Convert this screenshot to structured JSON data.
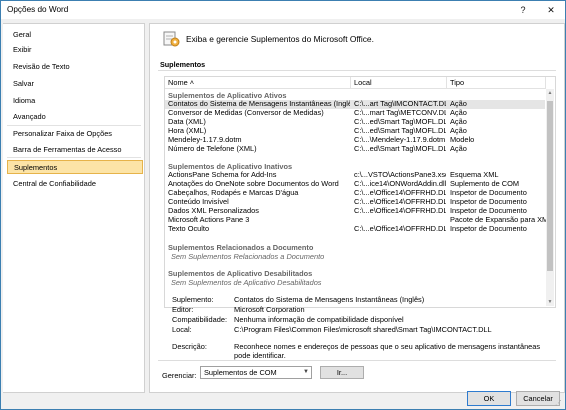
{
  "window": {
    "title": "Opções do Word",
    "help_label": "?",
    "close_label": "✕"
  },
  "sidebar": {
    "items": [
      {
        "label": "Geral",
        "selected": false
      },
      {
        "label": "Exibir",
        "selected": false
      },
      {
        "label": "Revisão de Texto",
        "selected": false
      },
      {
        "label": "Salvar",
        "selected": false
      },
      {
        "label": "Idioma",
        "selected": false
      },
      {
        "label": "Avançado",
        "selected": false
      },
      {
        "label": "Personalizar Faixa de Opções",
        "selected": false
      },
      {
        "label": "Barra de Ferramentas de Acesso Rápido",
        "selected": false
      },
      {
        "label": "Suplementos",
        "selected": true
      },
      {
        "label": "Central de Confiabilidade",
        "selected": false
      }
    ]
  },
  "main": {
    "header_text": "Exiba e gerencie Suplementos do Microsoft Office.",
    "section_title": "Suplementos",
    "grid": {
      "columns": [
        "Nome ˄",
        "Local",
        "Tipo"
      ],
      "groups": [
        {
          "title": "Suplementos de Aplicativo Ativos",
          "rows": [
            [
              "Contatos do Sistema de Mensagens Instantâneas (Inglês)",
              "C:\\...art Tag\\IMCONTACT.DLL",
              "Ação"
            ],
            [
              "Conversor de Medidas (Conversor de Medidas)",
              "C:\\...mart Tag\\METCONV.DLL",
              "Ação"
            ],
            [
              "Data (XML)",
              "C:\\...ed\\Smart Tag\\MOFL.DLL",
              "Ação"
            ],
            [
              "Hora (XML)",
              "C:\\...ed\\Smart Tag\\MOFL.DLL",
              "Ação"
            ],
            [
              "Mendeley-1.17.9.dotm",
              "C:\\...\\Mendeley-1.17.9.dotm",
              "Modelo"
            ],
            [
              "Número de Telefone (XML)",
              "C:\\...ed\\Smart Tag\\MOFL.DLL",
              "Ação"
            ]
          ]
        },
        {
          "title": "Suplementos de Aplicativo Inativos",
          "rows": [
            [
              "ActionsPane Schema for Add-Ins",
              "c:\\...VSTO\\ActionsPane3.xsd",
              "Esquema XML"
            ],
            [
              "Anotações do OneNote sobre Documentos do Word",
              "C:\\...ice14\\ONWordAddin.dll",
              "Suplemento de COM"
            ],
            [
              "Cabeçalhos, Rodapés e Marcas D'água",
              "C:\\...e\\Office14\\OFFRHD.DLL",
              "Inspetor de Documento"
            ],
            [
              "Conteúdo Invisível",
              "C:\\...e\\Office14\\OFFRHD.DLL",
              "Inspetor de Documento"
            ],
            [
              "Dados XML Personalizados",
              "C:\\...e\\Office14\\OFFRHD.DLL",
              "Inspetor de Documento"
            ],
            [
              "Microsoft Actions Pane 3",
              "",
              "Pacote de Expansão para XML"
            ],
            [
              "Texto Oculto",
              "C:\\...e\\Office14\\OFFRHD.DLL",
              "Inspetor de Documento"
            ]
          ]
        },
        {
          "title": "Suplementos Relacionados a Documento",
          "note": "Sem Suplementos Relacionados a Documento"
        },
        {
          "title": "Suplementos de Aplicativo Desabilitados",
          "note": "Sem Suplementos de Aplicativo Desabilitados"
        }
      ]
    },
    "details": {
      "publisher_label": "Suplemento:",
      "publisher_value": "Contatos do Sistema de Mensagens Instantâneas (Inglês)",
      "editor_label": "Editor:",
      "editor_value": "Microsoft Corporation",
      "compat_label": "Compatibilidade:",
      "compat_value": "Nenhuma informação de compatibilidade disponível",
      "local_label": "Local:",
      "local_value": "C:\\Program Files\\Common Files\\microsoft shared\\Smart Tag\\IMCONTACT.DLL",
      "desc_label": "Descrição:",
      "desc_value": "Reconhece nomes e endereços de pessoas que o seu aplicativo de mensagens instantâneas pode identificar."
    },
    "manage": {
      "label": "Gerenciar:",
      "selected": "Suplementos de COM",
      "go_label": "Ir..."
    }
  },
  "footer": {
    "ok_label": "OK",
    "cancel_label": "Cancelar"
  }
}
